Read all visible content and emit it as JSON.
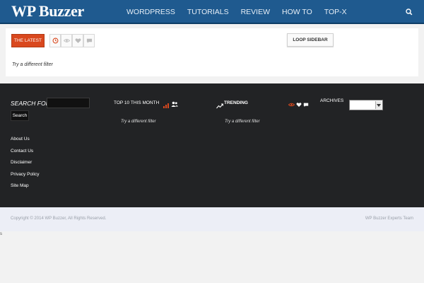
{
  "header": {
    "logo": "WP Buzzer",
    "nav": [
      "WORDPRESS",
      "TUTORIALS",
      "REVIEW",
      "HOW TO",
      "TOP-X"
    ]
  },
  "main": {
    "tab_latest": "THE LATEST",
    "loop_sidebar": "LOOP SIDEBAR",
    "filter_message": "Try a different filter"
  },
  "footer": {
    "search_label": "SEARCH FOR:",
    "search_button": "Search",
    "top10_title": "TOP 10 THIS MONTH",
    "top10_message": "Try a different filter",
    "trending_title": "TRENDING",
    "trending_message": "Try a different filter",
    "archives_title": "ARCHIVES",
    "links": [
      "About Us",
      "Contact Us",
      "Disclaimer",
      "Privacy Policy",
      "Site Map"
    ]
  },
  "bottom": {
    "copyright": "Copyright © 2014 WP Buzzer, All Rights Reserved.",
    "team": "WP Buzzer Experts Team",
    "stray": "s"
  },
  "colors": {
    "header_bg": "#1f5a8f",
    "accent": "#d9481e",
    "footer_bg": "#222325"
  }
}
